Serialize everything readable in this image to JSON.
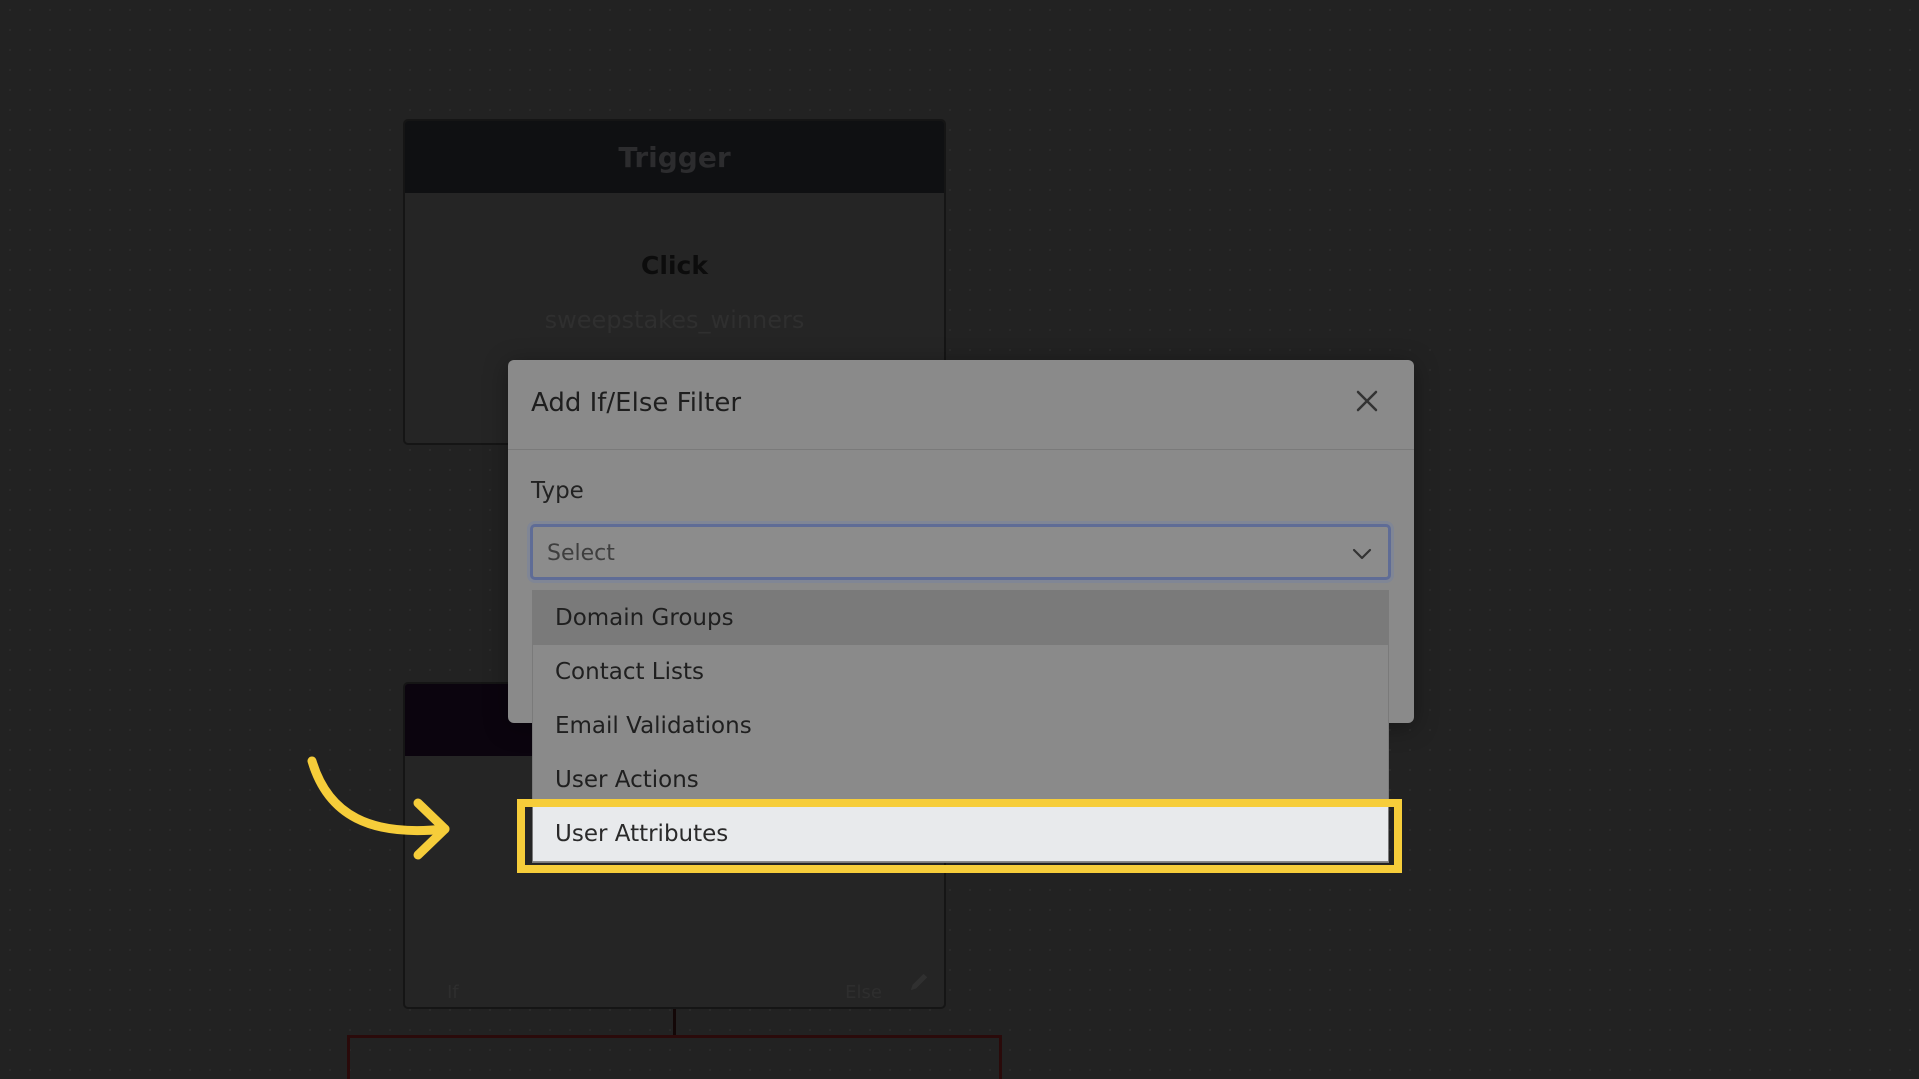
{
  "canvas": {
    "trigger_node": {
      "header": "Trigger",
      "title": "Click",
      "subtitle": "sweepstakes_winners"
    },
    "filter_node": {
      "branch_if": "If",
      "branch_else": "Else",
      "edit_icon": "pencil-icon"
    }
  },
  "modal": {
    "title": "Add If/Else Filter",
    "close_icon": "close-icon",
    "type_label": "Type",
    "select_placeholder": "Select",
    "select_icon": "chevron-down-icon"
  },
  "dropdown": {
    "options": [
      {
        "label": "Domain Groups",
        "state": "hover"
      },
      {
        "label": "Contact Lists",
        "state": "normal"
      },
      {
        "label": "Email Validations",
        "state": "normal"
      },
      {
        "label": "User Actions",
        "state": "normal"
      },
      {
        "label": "User Attributes",
        "state": "highlighted"
      }
    ]
  },
  "colors": {
    "highlight": "#f6cd3a",
    "background": "#222222",
    "modal": "#8a8a8a",
    "focus_ring": "#5f6c96"
  }
}
